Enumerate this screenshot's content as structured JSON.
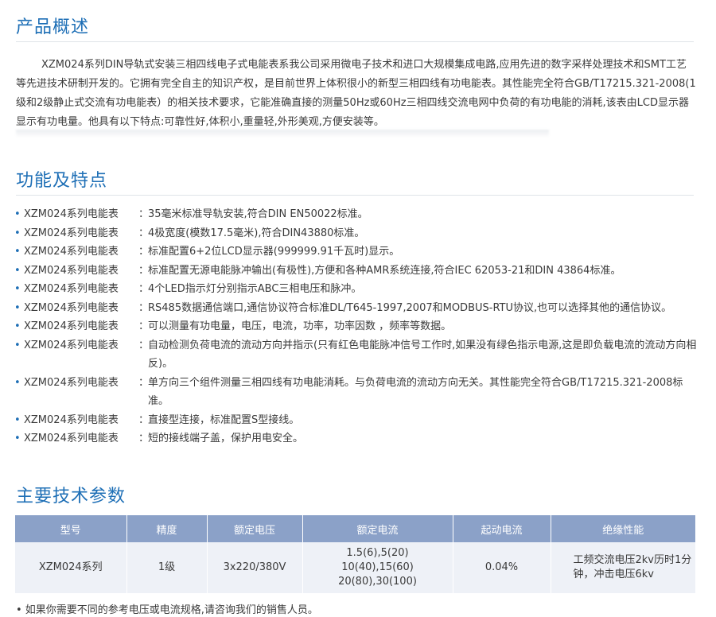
{
  "overview": {
    "title": "产品概述",
    "text": "XZM024系列DIN导轨式安装三相四线电子式电能表系我公司采用微电子技术和进口大规模集成电路,应用先进的数字采样处理技术和SMT工艺等先进技术研制开发的。它拥有完全自主的知识产权，是目前世界上体积很小的新型三相四线有功电能表。其性能完全符合GB/T17215.321-2008(1级和2级静止式交流有功电能表）的相关技术要求，它能准确直接的测量50Hz或60Hz三相四线交流电网中负荷的有功电能的消耗,该表由LCD显示器显示有功电量。他具有以下特点:可靠性好,体积小,重量轻,外形美观,方便安装等。"
  },
  "features": {
    "title": "功能及特点",
    "separator": "：",
    "items": [
      {
        "name": "XZM024系列电能表",
        "desc": "35毫米标准导轨安装,符合DIN EN50022标准。"
      },
      {
        "name": "XZM024系列电能表",
        "desc": "4极宽度(模数17.5毫米),符合DIN43880标准。"
      },
      {
        "name": "XZM024系列电能表",
        "desc": "标准配置6+2位LCD显示器(999999.91千瓦时)显示。"
      },
      {
        "name": "XZM024系列电能表",
        "desc": "标准配置无源电能脉冲输出(有极性),方便和各种AMR系统连接,符合IEC 62053-21和DIN 43864标准。"
      },
      {
        "name": "XZM024系列电能表",
        "desc": "4个LED指示灯分别指示ABC三相电压和脉冲。"
      },
      {
        "name": "XZM024系列电能表",
        "desc": "RS485数据通信端口,通信协议符合标准DL/T645-1997,2007和MODBUS-RTU协议,也可以选择其他的通信协议。"
      },
      {
        "name": "XZM024系列电能表",
        "desc": "可以测量有功电量，电压，电流，功率，功率因数 ，频率等数据。"
      },
      {
        "name": "XZM024系列电能表",
        "desc": "自动检测负荷电流的流动方向并指示(只有红色电能脉冲信号工作时,如果没有绿色指示电源,这是即负载电流的流动方向相反)。"
      },
      {
        "name": "XZM024系列电能表",
        "desc": "单方向三个组件测量三相四线有功电能消耗。与负荷电流的流动方向无关。其性能完全符合GB/T17215.321-2008标准。"
      },
      {
        "name": "XZM024系列电能表",
        "desc": "直接型连接，标准配置S型接线。"
      },
      {
        "name": "XZM024系列电能表",
        "desc": "短的接线端子盖，保护用电安全。"
      }
    ]
  },
  "specs": {
    "title": "主要技术参数",
    "headers": [
      "型号",
      "精度",
      "额定电压",
      "额定电流",
      "起动电流",
      "绝缘性能"
    ],
    "row": {
      "model": "XZM024系列",
      "accuracy": "1级",
      "voltage": "3x220/380V",
      "current_lines": [
        "1.5(6),5(20)",
        "10(40),15(60)",
        "20(80),30(100)"
      ],
      "start_current": "0.04%",
      "insulation": "工频交流电压2kv历时1分钟，冲击电压6kv"
    }
  },
  "footnote": "• 如果你需要不同的参考电压或电流规格,请咨询我们的销售人员。",
  "colors": {
    "accent": "#1e6fb6",
    "table_header_bg": "#8ba1c8",
    "table_row_bg": "#eef1f7"
  }
}
